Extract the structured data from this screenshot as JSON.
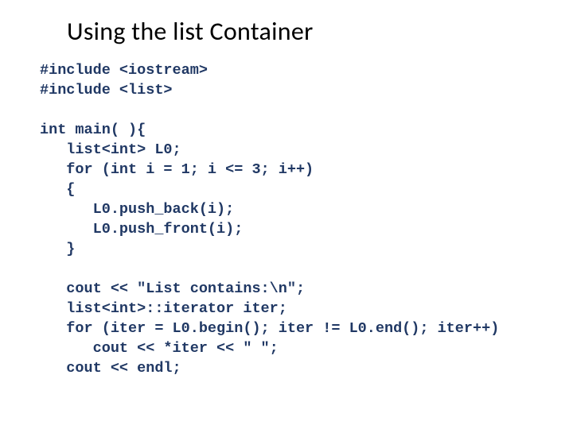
{
  "title": "Using the list Container",
  "code": {
    "lines": [
      "#include <iostream>",
      "#include <list>",
      "",
      "int main( ){",
      "   list<int> L0;",
      "   for (int i = 1; i <= 3; i++)",
      "   {",
      "      L0.push_back(i);",
      "      L0.push_front(i);",
      "   }",
      "",
      "   cout << \"List contains:\\n\";",
      "   list<int>::iterator iter;",
      "   for (iter = L0.begin(); iter != L0.end(); iter++)",
      "      cout << *iter << \" \";",
      "   cout << endl;"
    ]
  }
}
